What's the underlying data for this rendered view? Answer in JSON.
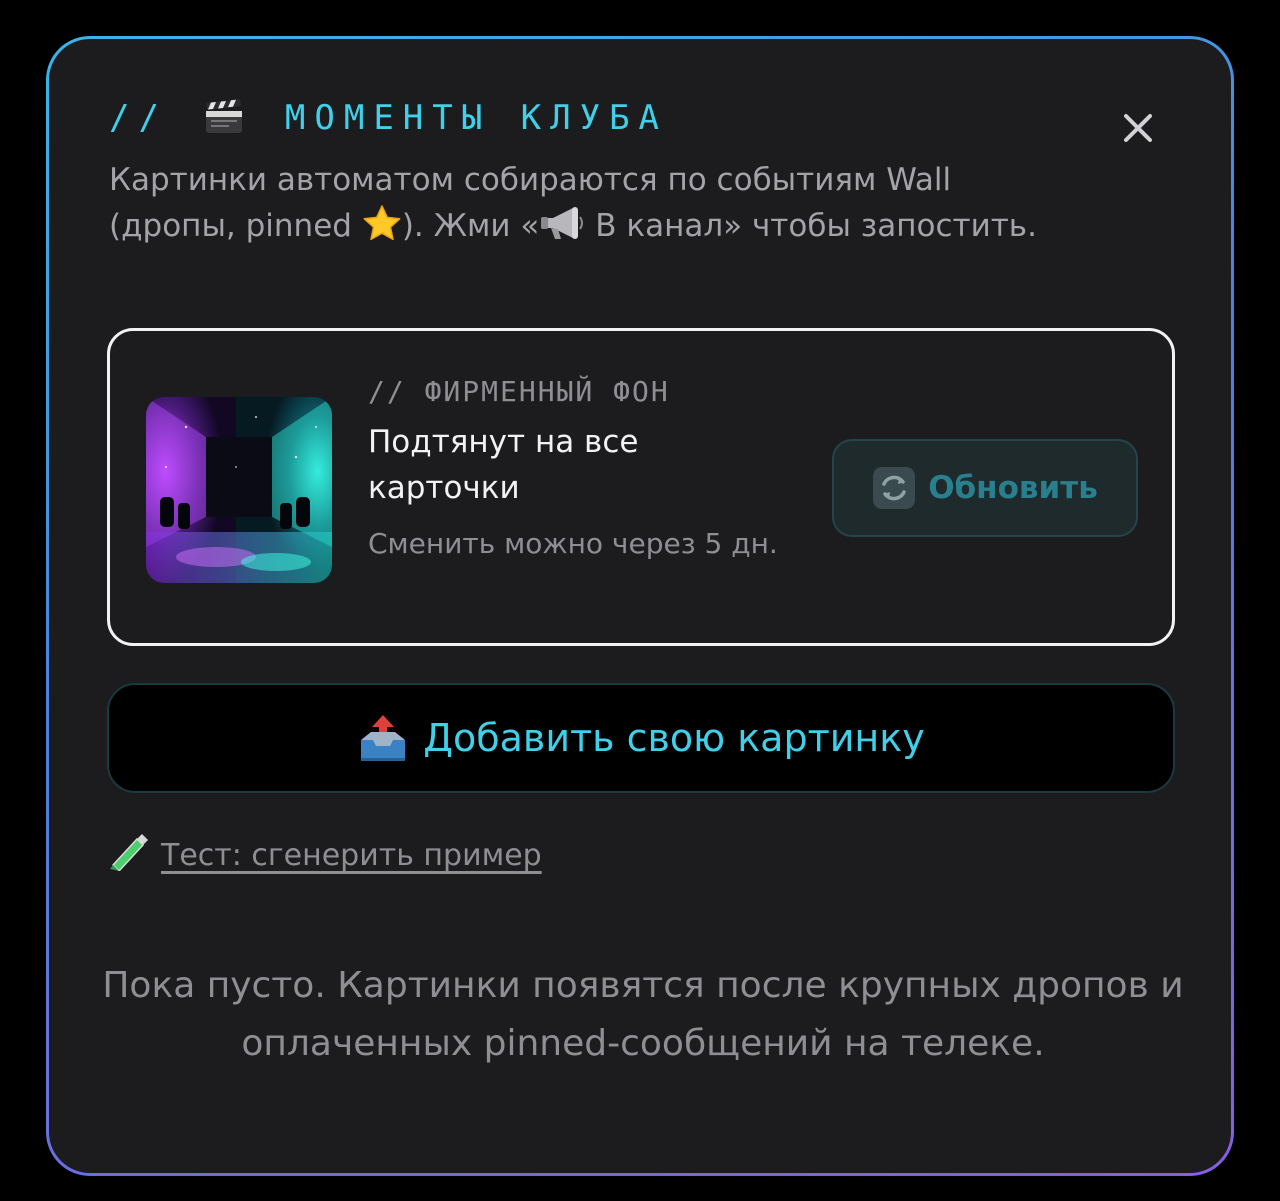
{
  "header": {
    "prefix": "//",
    "title": "МОМЕНТЫ КЛУБА",
    "title_icon": "clapperboard-icon",
    "close_icon": "close-icon"
  },
  "description": {
    "part1": "Картинки автоматом собираются по событиям Wall (дропы, pinned ",
    "part2": "). Жми «",
    "part3": " В канал» чтобы запостить."
  },
  "background_card": {
    "tag": "// ФИРМЕННЫЙ ФОН",
    "title": "Подтянут на все карточки",
    "note": "Сменить можно через 5 дн.",
    "refresh_button": "Обновить"
  },
  "add_button": {
    "label": "Добавить свою картинку",
    "icon": "outbox-tray-icon"
  },
  "test_link": {
    "label": "Тест: сгенерить пример",
    "icon": "test-tube-icon"
  },
  "empty_state": {
    "text": "Пока пусто. Картинки появятся после крупных дропов и оплаченных pinned-сообщений на телеке."
  },
  "colors": {
    "accent": "#3fd0ea",
    "panel": "#1c1c1e",
    "muted": "#8e8e93"
  }
}
